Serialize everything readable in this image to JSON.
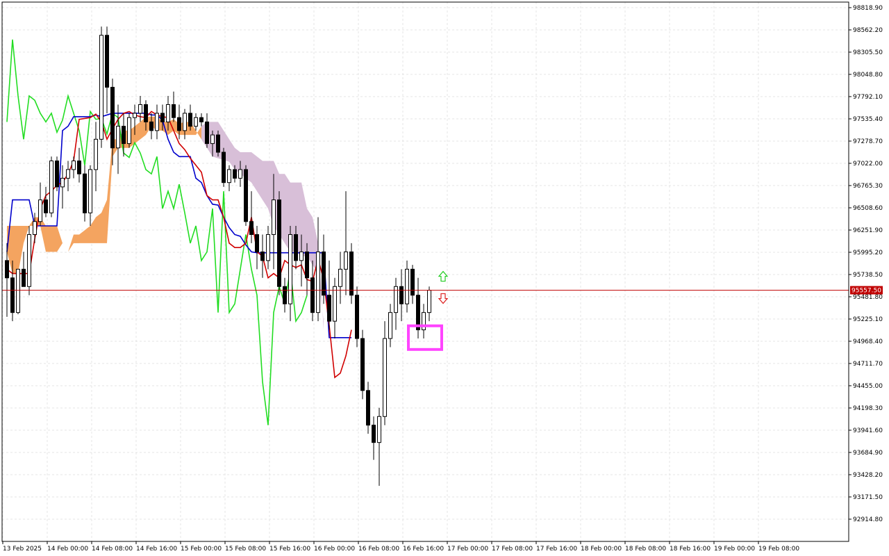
{
  "chart_data": {
    "type": "candlestick",
    "instrument_note": "",
    "y_axis": {
      "min": 92914.8,
      "max": 98818.9,
      "tick_labels": [
        "98818.90",
        "98562.20",
        "98305.50",
        "98048.80",
        "97792.10",
        "97535.40",
        "97278.70",
        "97022.00",
        "96765.30",
        "96508.60",
        "96251.90",
        "95995.20",
        "95738.50",
        "95481.80",
        "95225.10",
        "94968.40",
        "94711.70",
        "94455.00",
        "94198.30",
        "93941.60",
        "93684.90",
        "93428.20",
        "93171.50",
        "92914.80"
      ]
    },
    "x_axis": {
      "tick_labels": [
        "13 Feb 2025",
        "14 Feb 00:00",
        "14 Feb 08:00",
        "14 Feb 16:00",
        "15 Feb 00:00",
        "15 Feb 08:00",
        "15 Feb 16:00",
        "16 Feb 00:00",
        "16 Feb 08:00",
        "16 Feb 16:00",
        "17 Feb 00:00",
        "17 Feb 08:00",
        "17 Feb 16:00",
        "18 Feb 00:00",
        "18 Feb 08:00",
        "18 Feb 16:00",
        "19 Feb 00:00",
        "19 Feb 08:00"
      ]
    },
    "current_price": {
      "value": 95557.5,
      "label": "95557.50",
      "color": "#c00000"
    },
    "grid": true,
    "colors": {
      "bull_body": "#ffffff",
      "bear_body": "#000000",
      "tenkan": "#d00000",
      "kijun": "#0000cc",
      "chikou": "#22dd22",
      "cloud_bull": "#f4a460",
      "cloud_bear": "#d8bfd8",
      "highlight_box": "#ff44ff"
    },
    "tenkan_sen": [
      95800,
      95750,
      95750,
      95750,
      95750,
      96150,
      96500,
      96650,
      96700,
      96770,
      96800,
      96900,
      97050,
      97530,
      97540,
      97550,
      97590,
      97500,
      97300,
      97420,
      97530,
      97600,
      97620,
      97580,
      97560,
      97550,
      97620,
      97580,
      97560,
      97550,
      97400,
      97250,
      97180,
      97080,
      97000,
      96920,
      96650,
      96600,
      96600,
      96400,
      96100,
      96050,
      96050,
      96100,
      96400,
      96000,
      95950,
      95700,
      95750,
      95700,
      95900,
      95850,
      95820,
      95850,
      95680,
      95660,
      95920,
      95680,
      95150,
      94550,
      94600,
      94800,
      95100
    ],
    "kijun_sen": [
      96000,
      96600,
      96600,
      96600,
      96600,
      96300,
      96300,
      96300,
      96300,
      96300,
      97400,
      97450,
      97560,
      97560,
      97560,
      97560,
      97580,
      97560,
      97580,
      97600,
      97600,
      97600,
      97600,
      97600,
      97600,
      97600,
      97580,
      97580,
      97520,
      97300,
      97150,
      97100,
      97100,
      97100,
      96850,
      96800,
      96650,
      96550,
      96540,
      96400,
      96280,
      96200,
      96180,
      96080,
      96000,
      95990,
      95990,
      95990,
      95990,
      95990,
      95990,
      95990,
      95990,
      95990,
      95990,
      95990,
      95990,
      95990,
      95010,
      95010,
      95010,
      95010,
      95010
    ],
    "chikou_span": [
      97500,
      98450,
      97800,
      97300,
      97800,
      97750,
      97600,
      97500,
      97600,
      97380,
      97520,
      97800,
      97600,
      97400,
      97000,
      97620,
      97530,
      97540,
      97360,
      97600,
      97550,
      97140,
      97090,
      97260,
      97140,
      96950,
      96900,
      97100,
      96500,
      96700,
      96500,
      96780,
      96450,
      96100,
      96300,
      95900,
      96000,
      96500,
      95300,
      96700,
      95300,
      95400,
      95800,
      96200,
      95800,
      95500,
      94500,
      94000,
      95300,
      95600,
      95400,
      95800,
      95200,
      95300,
      95500
    ],
    "cloud": {
      "senkou_a": [
        96300,
        96300,
        96300,
        96300,
        96300,
        96400,
        96400,
        96300,
        96300,
        96300,
        96100,
        96000,
        96200,
        96200,
        96250,
        96300,
        96400,
        96450,
        96600,
        97300,
        97300,
        97400,
        97400,
        97450,
        97500,
        97560,
        97560,
        97560,
        97500,
        97500,
        97530,
        97480,
        97500,
        97500,
        97400,
        97300,
        97200,
        97100,
        97080,
        97060,
        97040,
        96950,
        96900,
        96850,
        96800,
        96700,
        96600,
        96500,
        96300,
        96200,
        96100,
        96000,
        96000,
        95950,
        95950,
        95850,
        95750,
        95200
      ],
      "senkou_b": [
        96000,
        95750,
        95750,
        96100,
        96300,
        96300,
        96300,
        96000,
        96000,
        96000,
        96100,
        96000,
        96100,
        96100,
        96100,
        96100,
        96100,
        96100,
        96100,
        97100,
        97200,
        97200,
        97200,
        97250,
        97300,
        97350,
        97450,
        97400,
        97400,
        97350,
        97400,
        97350,
        97350,
        97350,
        97350,
        97450,
        97500,
        97500,
        97500,
        97400,
        97300,
        97200,
        97150,
        97150,
        97150,
        97100,
        97050,
        97050,
        97050,
        96900,
        96900,
        96800,
        96800,
        96800,
        96500,
        96400,
        96100,
        95100
      ]
    },
    "candles": [
      {
        "o": 95900,
        "h": 96100,
        "l": 95250,
        "c": 95700
      },
      {
        "o": 95700,
        "h": 95900,
        "l": 95200,
        "c": 95300
      },
      {
        "o": 95300,
        "h": 95800,
        "l": 95280,
        "c": 95800
      },
      {
        "o": 95800,
        "h": 96000,
        "l": 95600,
        "c": 95600
      },
      {
        "o": 95600,
        "h": 96300,
        "l": 95500,
        "c": 96200
      },
      {
        "o": 96200,
        "h": 96450,
        "l": 96100,
        "c": 96350
      },
      {
        "o": 96350,
        "h": 96800,
        "l": 96300,
        "c": 96600
      },
      {
        "o": 96600,
        "h": 96750,
        "l": 96400,
        "c": 96450
      },
      {
        "o": 96450,
        "h": 97100,
        "l": 96400,
        "c": 97050
      },
      {
        "o": 97050,
        "h": 97100,
        "l": 96700,
        "c": 96750
      },
      {
        "o": 96750,
        "h": 97000,
        "l": 96500,
        "c": 96850
      },
      {
        "o": 96850,
        "h": 97050,
        "l": 96700,
        "c": 96950
      },
      {
        "o": 96950,
        "h": 97100,
        "l": 96850,
        "c": 97050
      },
      {
        "o": 97050,
        "h": 97200,
        "l": 96800,
        "c": 96900
      },
      {
        "o": 96900,
        "h": 97000,
        "l": 96350,
        "c": 96450
      },
      {
        "o": 96450,
        "h": 97000,
        "l": 96300,
        "c": 96950
      },
      {
        "o": 96950,
        "h": 97500,
        "l": 96700,
        "c": 97300
      },
      {
        "o": 97300,
        "h": 98600,
        "l": 97200,
        "c": 98500
      },
      {
        "o": 98500,
        "h": 98600,
        "l": 97600,
        "c": 97900
      },
      {
        "o": 97900,
        "h": 98000,
        "l": 97000,
        "c": 97200
      },
      {
        "o": 97200,
        "h": 97700,
        "l": 96900,
        "c": 97450
      },
      {
        "o": 97450,
        "h": 97600,
        "l": 97100,
        "c": 97250
      },
      {
        "o": 97250,
        "h": 97600,
        "l": 97200,
        "c": 97550
      },
      {
        "o": 97550,
        "h": 97700,
        "l": 97350,
        "c": 97600
      },
      {
        "o": 97600,
        "h": 97800,
        "l": 97500,
        "c": 97700
      },
      {
        "o": 97700,
        "h": 97750,
        "l": 97400,
        "c": 97500
      },
      {
        "o": 97500,
        "h": 97600,
        "l": 97300,
        "c": 97400
      },
      {
        "o": 97400,
        "h": 97700,
        "l": 97300,
        "c": 97600
      },
      {
        "o": 97600,
        "h": 97700,
        "l": 97400,
        "c": 97500
      },
      {
        "o": 97500,
        "h": 97800,
        "l": 97400,
        "c": 97700
      },
      {
        "o": 97700,
        "h": 97850,
        "l": 97500,
        "c": 97550
      },
      {
        "o": 97550,
        "h": 97700,
        "l": 97300,
        "c": 97400
      },
      {
        "o": 97400,
        "h": 97650,
        "l": 97300,
        "c": 97600
      },
      {
        "o": 97600,
        "h": 97700,
        "l": 97400,
        "c": 97450
      },
      {
        "o": 97450,
        "h": 97600,
        "l": 97400,
        "c": 97550
      },
      {
        "o": 97550,
        "h": 97600,
        "l": 97450,
        "c": 97500
      },
      {
        "o": 97500,
        "h": 97600,
        "l": 97200,
        "c": 97250
      },
      {
        "o": 97250,
        "h": 97400,
        "l": 97100,
        "c": 97350
      },
      {
        "o": 97350,
        "h": 97400,
        "l": 97100,
        "c": 97150
      },
      {
        "o": 97150,
        "h": 97200,
        "l": 96750,
        "c": 96800
      },
      {
        "o": 96800,
        "h": 97000,
        "l": 96700,
        "c": 96950
      },
      {
        "o": 96950,
        "h": 97000,
        "l": 96800,
        "c": 96850
      },
      {
        "o": 96850,
        "h": 97050,
        "l": 96750,
        "c": 96950
      },
      {
        "o": 96950,
        "h": 97000,
        "l": 96300,
        "c": 96350
      },
      {
        "o": 96350,
        "h": 96700,
        "l": 96100,
        "c": 96200
      },
      {
        "o": 96200,
        "h": 96300,
        "l": 95800,
        "c": 96000
      },
      {
        "o": 96000,
        "h": 96200,
        "l": 95700,
        "c": 95900
      },
      {
        "o": 95900,
        "h": 96300,
        "l": 95800,
        "c": 96200
      },
      {
        "o": 96200,
        "h": 96900,
        "l": 95800,
        "c": 96600
      },
      {
        "o": 96600,
        "h": 96700,
        "l": 95500,
        "c": 95600
      },
      {
        "o": 95600,
        "h": 95700,
        "l": 95300,
        "c": 95400
      },
      {
        "o": 95400,
        "h": 96300,
        "l": 95200,
        "c": 96200
      },
      {
        "o": 96200,
        "h": 96300,
        "l": 95800,
        "c": 95900
      },
      {
        "o": 95900,
        "h": 96200,
        "l": 95600,
        "c": 96000
      },
      {
        "o": 96000,
        "h": 96100,
        "l": 95500,
        "c": 95700
      },
      {
        "o": 95700,
        "h": 95900,
        "l": 95200,
        "c": 95300
      },
      {
        "o": 95300,
        "h": 96400,
        "l": 95200,
        "c": 96000
      },
      {
        "o": 96000,
        "h": 96200,
        "l": 95400,
        "c": 95500
      },
      {
        "o": 95500,
        "h": 95900,
        "l": 95100,
        "c": 95200
      },
      {
        "o": 95200,
        "h": 95700,
        "l": 95000,
        "c": 95600
      },
      {
        "o": 95600,
        "h": 96000,
        "l": 95400,
        "c": 95800
      },
      {
        "o": 95800,
        "h": 96700,
        "l": 95500,
        "c": 96000
      },
      {
        "o": 96000,
        "h": 96100,
        "l": 95400,
        "c": 95500
      },
      {
        "o": 95500,
        "h": 95600,
        "l": 94900,
        "c": 95000
      },
      {
        "o": 95000,
        "h": 95100,
        "l": 94300,
        "c": 94400
      },
      {
        "o": 94400,
        "h": 94500,
        "l": 93900,
        "c": 94000
      },
      {
        "o": 94000,
        "h": 94100,
        "l": 93600,
        "c": 93800
      },
      {
        "o": 93800,
        "h": 94200,
        "l": 93300,
        "c": 94100
      },
      {
        "o": 94100,
        "h": 95200,
        "l": 94000,
        "c": 95000
      },
      {
        "o": 95000,
        "h": 95400,
        "l": 94900,
        "c": 95300
      },
      {
        "o": 95300,
        "h": 95700,
        "l": 95100,
        "c": 95600
      },
      {
        "o": 95600,
        "h": 95800,
        "l": 95200,
        "c": 95400
      },
      {
        "o": 95400,
        "h": 95900,
        "l": 95300,
        "c": 95800
      },
      {
        "o": 95800,
        "h": 95850,
        "l": 95400,
        "c": 95500
      },
      {
        "o": 95500,
        "h": 95700,
        "l": 95000,
        "c": 95100
      },
      {
        "o": 95100,
        "h": 95400,
        "l": 95000,
        "c": 95300
      },
      {
        "o": 95300,
        "h": 95600,
        "l": 95200,
        "c": 95557.5
      }
    ]
  }
}
